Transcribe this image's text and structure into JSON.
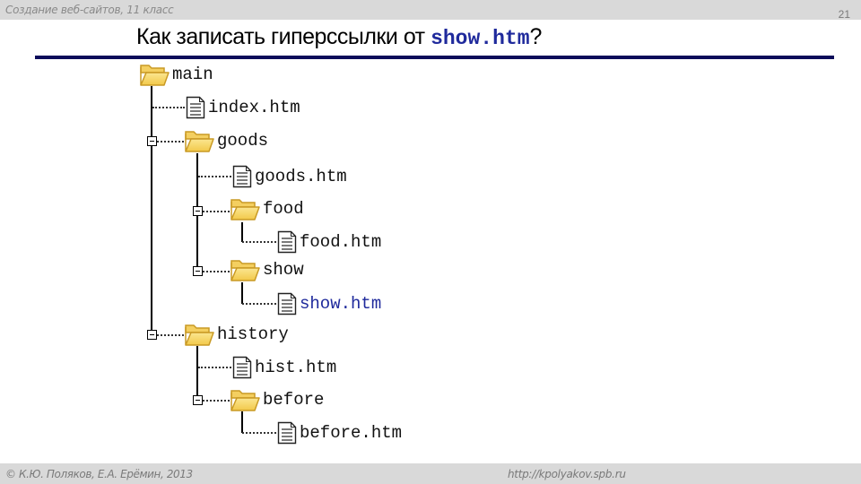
{
  "header": {
    "course": "Создание веб-сайтов, 11 класс",
    "slide_number": "21",
    "title_text": "Как записать гиперссылки от ",
    "title_code": "show.htm",
    "title_suffix": "?"
  },
  "footer": {
    "copyright": "© К.Ю. Поляков, Е.А. Ерёмин, 2013",
    "url": "http://kpolyakov.spb.ru"
  },
  "tree": {
    "main": {
      "label": "main",
      "type": "folder",
      "icon": "folder-open-icon"
    },
    "index": {
      "label": "index.htm",
      "type": "file",
      "icon": "file-icon"
    },
    "goods": {
      "label": "goods",
      "type": "folder",
      "icon": "folder-open-icon",
      "expanded": true
    },
    "goods_htm": {
      "label": "goods.htm",
      "type": "file",
      "icon": "file-icon"
    },
    "food": {
      "label": "food",
      "type": "folder",
      "icon": "folder-open-icon",
      "expanded": true
    },
    "food_htm": {
      "label": "food.htm",
      "type": "file",
      "icon": "file-icon"
    },
    "show": {
      "label": "show",
      "type": "folder",
      "icon": "folder-open-icon",
      "expanded": true
    },
    "show_htm": {
      "label": "show.htm",
      "type": "file",
      "icon": "file-icon",
      "highlighted": true
    },
    "history": {
      "label": "history",
      "type": "folder",
      "icon": "folder-open-icon",
      "expanded": true
    },
    "hist_htm": {
      "label": "hist.htm",
      "type": "file",
      "icon": "file-icon"
    },
    "before": {
      "label": "before",
      "type": "folder",
      "icon": "folder-open-icon",
      "expanded": true
    },
    "before_htm": {
      "label": "before.htm",
      "type": "file",
      "icon": "file-icon"
    }
  },
  "colors": {
    "highlight": "#1f2a9c",
    "title_rule": "#0c0c5a",
    "folder": "#f5d25a"
  }
}
